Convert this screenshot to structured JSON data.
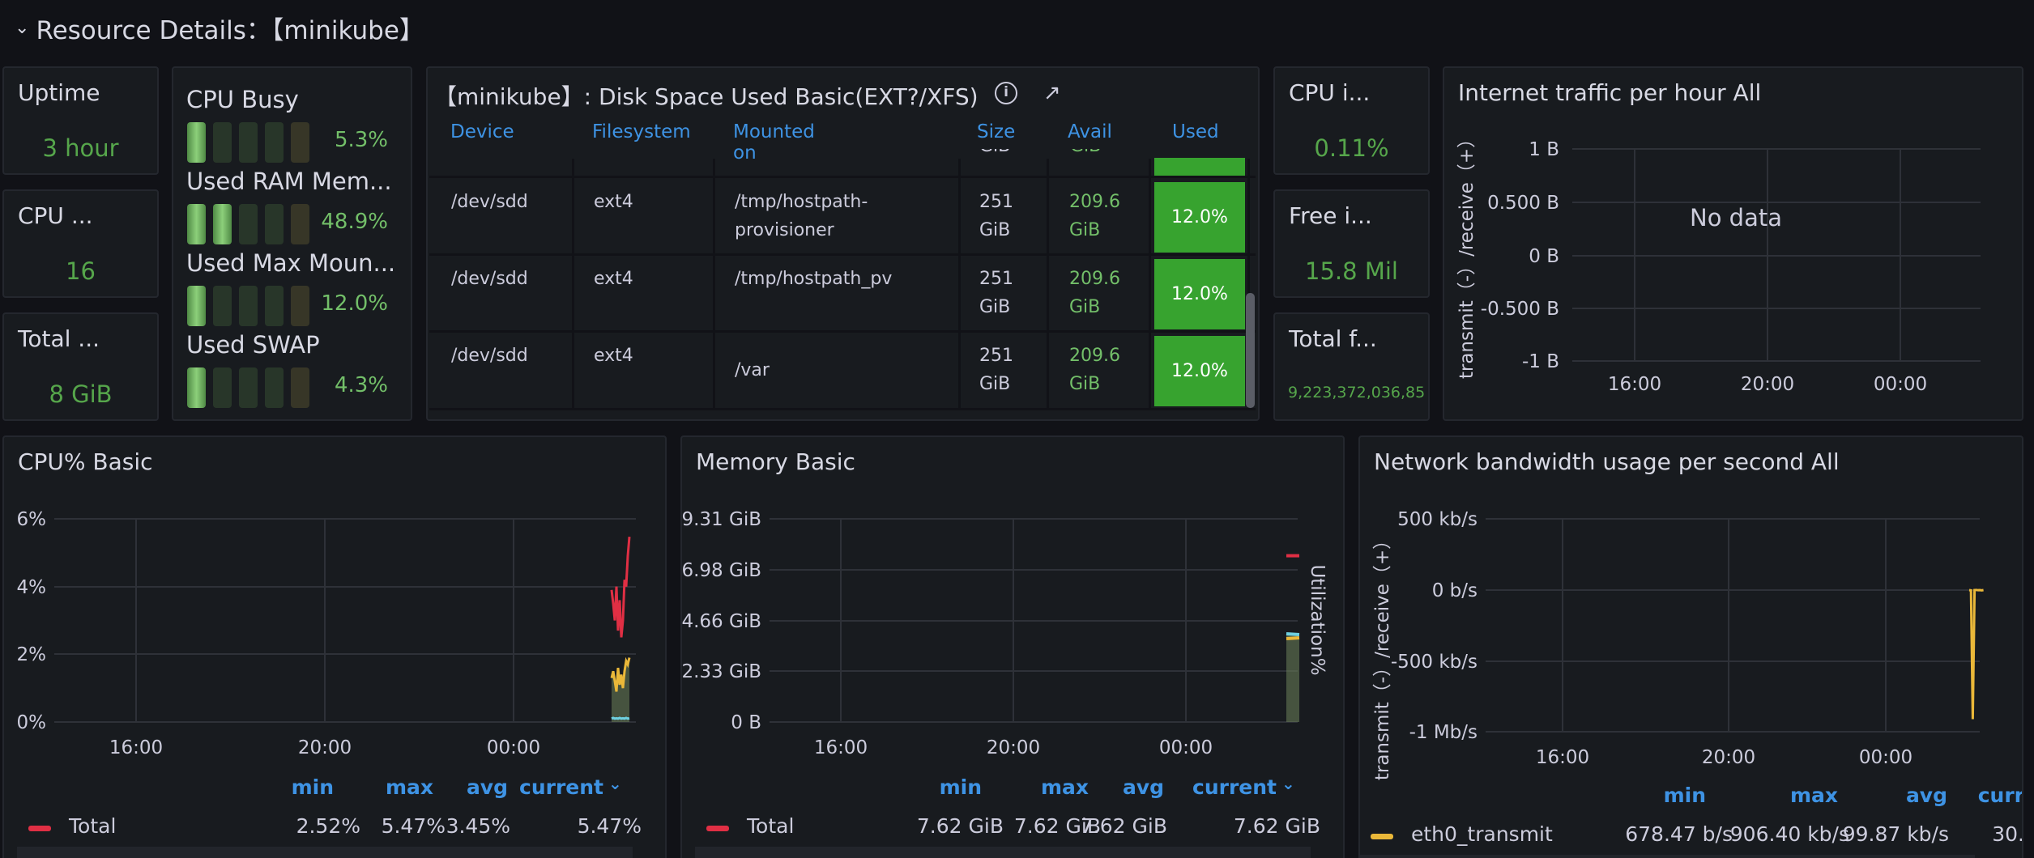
{
  "row_header": {
    "title": "Resource Details：【minikube】"
  },
  "stats": {
    "uptime": {
      "title": "Uptime",
      "value": "3 hour"
    },
    "cpu_cores": {
      "title": "CPU ...",
      "value": "16"
    },
    "total_ram": {
      "title": "Total ...",
      "value": "8 GiB"
    },
    "cpu_iowait": {
      "title": "CPU i...",
      "value": "0.11%"
    },
    "free_inodes": {
      "title": "Free i...",
      "value": "15.8 Mil"
    },
    "total_fd": {
      "title": "Total f...",
      "value": "9,223,372,036,85"
    }
  },
  "gauges": [
    {
      "label": "CPU Busy",
      "value": "5.3%",
      "level": 0.053
    },
    {
      "label": "Used RAM Mem...",
      "value": "48.9%",
      "level": 0.489
    },
    {
      "label": "Used Max Moun...",
      "value": "12.0%",
      "level": 0.12
    },
    {
      "label": "Used SWAP",
      "value": "4.3%",
      "level": 0.043
    }
  ],
  "disk_table": {
    "title": "【minikube】: Disk Space Used Basic(EXT?/XFS)",
    "columns": [
      "Device",
      "Filesystem",
      "Mounted on",
      "Size",
      "Avail",
      "Used"
    ],
    "partial_row": {
      "size": "GiB",
      "avail": "GiB"
    },
    "rows": [
      {
        "device": "/dev/sdd",
        "fs": "ext4",
        "mount1": "/tmp/hostpath-",
        "mount2": "provisioner",
        "size1": "251",
        "size2": "GiB",
        "avail1": "209.6",
        "avail2": "GiB",
        "used": "12.0%"
      },
      {
        "device": "/dev/sdd",
        "fs": "ext4",
        "mount1": "/tmp/hostpath_pv",
        "mount2": "",
        "size1": "251",
        "size2": "GiB",
        "avail1": "209.6",
        "avail2": "GiB",
        "used": "12.0%"
      },
      {
        "device": "/dev/sdd",
        "fs": "ext4",
        "mount1": "",
        "mount2": "/var",
        "size1": "251",
        "size2": "GiB",
        "avail1": "209.6",
        "avail2": "GiB",
        "used": "12.0%"
      }
    ]
  },
  "internet_traffic": {
    "title": "Internet traffic per hour All",
    "no_data": "No data",
    "ylabel": "transmit（-）/receive（+）",
    "yticks": [
      "1 B",
      "0.500 B",
      "0 B",
      "-0.500 B",
      "-1 B"
    ],
    "xticks": [
      "16:00",
      "20:00",
      "00:00"
    ]
  },
  "cpu_chart": {
    "title": "CPU% Basic",
    "yticks": [
      "6%",
      "4%",
      "2%",
      "0%"
    ],
    "xticks": [
      "16:00",
      "20:00",
      "00:00"
    ],
    "legend_headers": [
      "min",
      "max",
      "avg",
      "current"
    ],
    "legend": [
      {
        "name": "Total",
        "min": "2.52%",
        "max": "5.47%",
        "avg": "3.45%",
        "current": "5.47%",
        "color": "#e02f44"
      }
    ],
    "colors": {
      "total": "#e02f44",
      "user": "#eab839",
      "system": "#6ed0e0"
    }
  },
  "memory_chart": {
    "title": "Memory Basic",
    "yticks": [
      "9.31 GiB",
      "6.98 GiB",
      "4.66 GiB",
      "2.33 GiB",
      "0 B"
    ],
    "xticks": [
      "16:00",
      "20:00",
      "00:00"
    ],
    "right_label": "Utilization%",
    "legend_headers": [
      "min",
      "max",
      "avg",
      "current"
    ],
    "legend": [
      {
        "name": "Total",
        "min": "7.62 GiB",
        "max": "7.62 GiB",
        "avg": "7.62 GiB",
        "current": "7.62 GiB",
        "color": "#e02f44"
      }
    ]
  },
  "network_chart": {
    "title": "Network bandwidth usage per second All",
    "ylabel": "transmit（-）/receive（+）",
    "yticks": [
      "500 kb/s",
      "0 b/s",
      "-500 kb/s",
      "-1 Mb/s"
    ],
    "xticks": [
      "16:00",
      "20:00",
      "00:00"
    ],
    "legend_headers": [
      "min",
      "max",
      "avg",
      "curr"
    ],
    "legend": [
      {
        "name": "eth0_transmit",
        "min": "678.47 b/s",
        "max": "906.40 kb/s",
        "avg": "99.87 kb/s",
        "current": "30.",
        "color": "#eab839"
      }
    ]
  }
}
